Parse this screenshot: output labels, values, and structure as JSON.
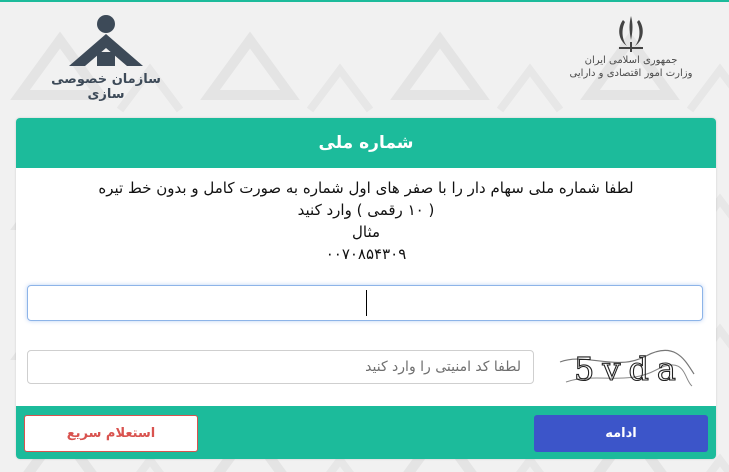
{
  "header": {
    "org_logo_text": "سازمان خصوصی سازی",
    "ministry_line1": "جمهوری اسلامی ایران",
    "ministry_line2": "وزارت امور اقتصادی و دارایی"
  },
  "card": {
    "title": "شماره ملی",
    "instruction_line1": "لطفا شماره ملی سهام دار را با صفر های اول شماره به صورت کامل و بدون خط تیره",
    "instruction_line2": "( ۱۰ رقمی ) وارد کنید",
    "example_label": "مثال",
    "example_value": "۰۰۷۰۸۵۴۳۰۹"
  },
  "national_id_input": {
    "value": "",
    "placeholder": ""
  },
  "captcha": {
    "placeholder": "لطفا کد امنیتی را وارد کنید",
    "code_text": "5vda"
  },
  "buttons": {
    "continue_label": "ادامه",
    "quick_inquiry_label": "استعلام سریع"
  },
  "colors": {
    "accent": "#1cbb9b",
    "primary_button": "#3c55c9",
    "danger_outline": "#d9534f",
    "background": "#f1f1f1"
  }
}
